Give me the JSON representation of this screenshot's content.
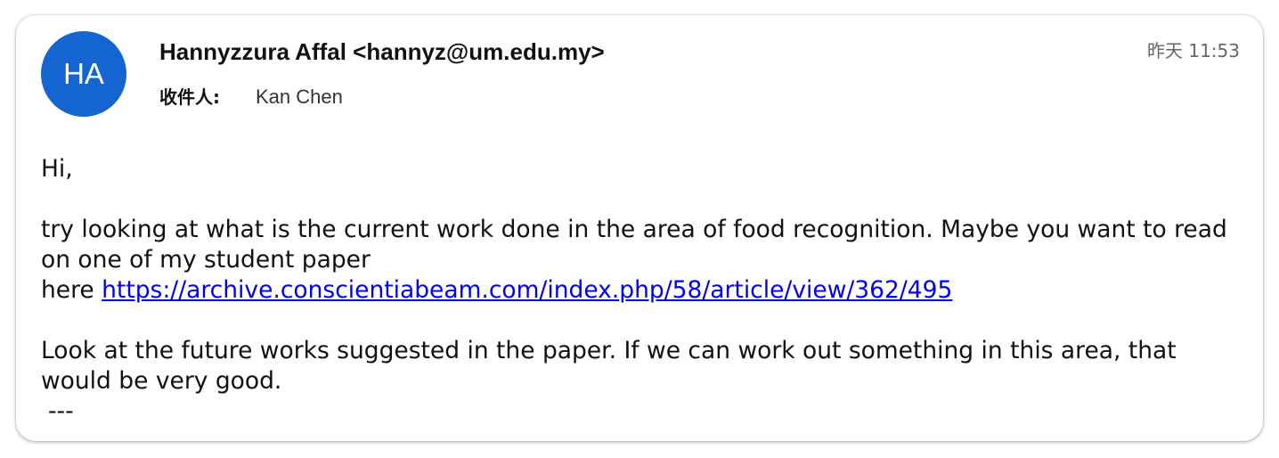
{
  "email": {
    "avatar_initials": "HA",
    "avatar_color": "#1565d0",
    "sender": "Hannyzzura Affal <hannyz@um.edu.my>",
    "recipient_label": "收件人:",
    "recipient_name": "Kan Chen",
    "timestamp": "昨天 11:53",
    "body": {
      "greeting": "Hi,",
      "paragraph1_line1": "try looking at what is the current work done in the area of food recognition. Maybe you want to read on one of my student paper",
      "paragraph1_here": "here ",
      "link_text": "https://archive.conscientiabeam.com/index.php/58/article/view/362/495",
      "paragraph2": "Look at the future works suggested in the paper. If we can work out something in this area, that would be very good.",
      "signature_sep": "---"
    },
    "link_color": "#0000ee"
  }
}
